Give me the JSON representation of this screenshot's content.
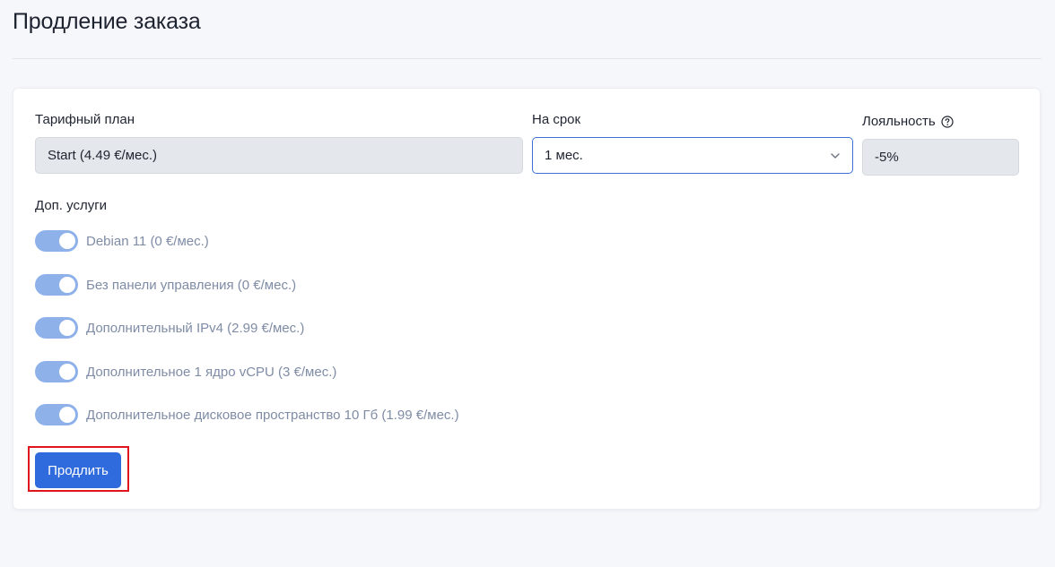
{
  "page": {
    "title": "Продление заказа"
  },
  "form": {
    "plan": {
      "label": "Тарифный план",
      "value": "Start (4.49 €/мес.)"
    },
    "term": {
      "label": "На срок",
      "selected": "1 мес."
    },
    "loyalty": {
      "label": "Лояльность",
      "value": "-5%",
      "help_icon": "question-circle-icon"
    },
    "addons": {
      "label": "Доп. услуги",
      "items": [
        {
          "label": "Debian 11 (0 €/мес.)",
          "enabled": true
        },
        {
          "label": "Без панели управления (0 €/мес.)",
          "enabled": true
        },
        {
          "label": "Дополнительный IPv4 (2.99 €/мес.)",
          "enabled": true
        },
        {
          "label": "Дополнительное 1 ядро vCPU (3 €/мес.)",
          "enabled": true
        },
        {
          "label": "Дополнительное дисковое пространство 10 Гб (1.99 €/мес.)",
          "enabled": true
        }
      ]
    },
    "submit_label": "Продлить"
  },
  "colors": {
    "accent": "#2f6bdc",
    "toggle_on_disabled": "#8fb1ea",
    "highlight": "#e0141c",
    "readonly_bg": "#e4e7eb"
  }
}
